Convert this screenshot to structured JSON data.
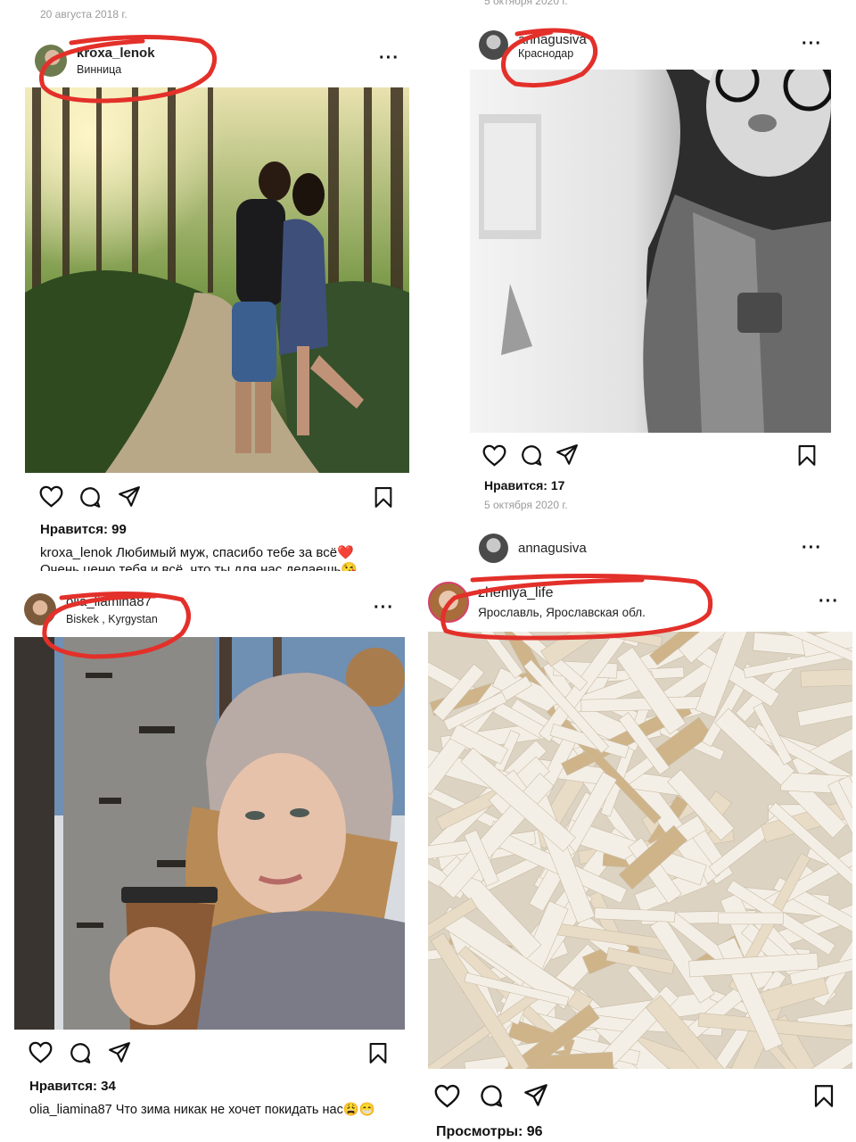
{
  "posts": [
    {
      "top_date": "20 августа 2018 г.",
      "username": "kroxa_lenok",
      "location": "Винница",
      "likes": "Нравится: 99",
      "caption_user": "kroxa_lenok",
      "caption_text": "Любимый муж, спасибо тебе за всё❤️",
      "caption_more": "Очень ценю тебя и всё, что ты для нас делаешь😘"
    },
    {
      "top_date": "5 октября 2020 г.",
      "username": "annagusiva",
      "location": "Краснодар",
      "likes": "Нравится: 17",
      "date": "5 октября 2020 г.",
      "next_username": "annagusiva"
    },
    {
      "username": "olia_liamina87",
      "location": "Biskek , Kyrgystan",
      "likes": "Нравится: 34",
      "caption_user": "olia_liamina87",
      "caption_text": "Что зима никак не хочет покидать нас😩😁"
    },
    {
      "username": "zheniya_life",
      "location": "Ярославль, Ярославская обл.",
      "views": "Просмотры: 96"
    }
  ],
  "icons": [
    "heart-icon",
    "comment-icon",
    "share-icon",
    "bookmark-icon",
    "more-icon"
  ],
  "colors": {
    "annotation_red": "#e3302a",
    "date_gray": "#9a9a9a"
  }
}
